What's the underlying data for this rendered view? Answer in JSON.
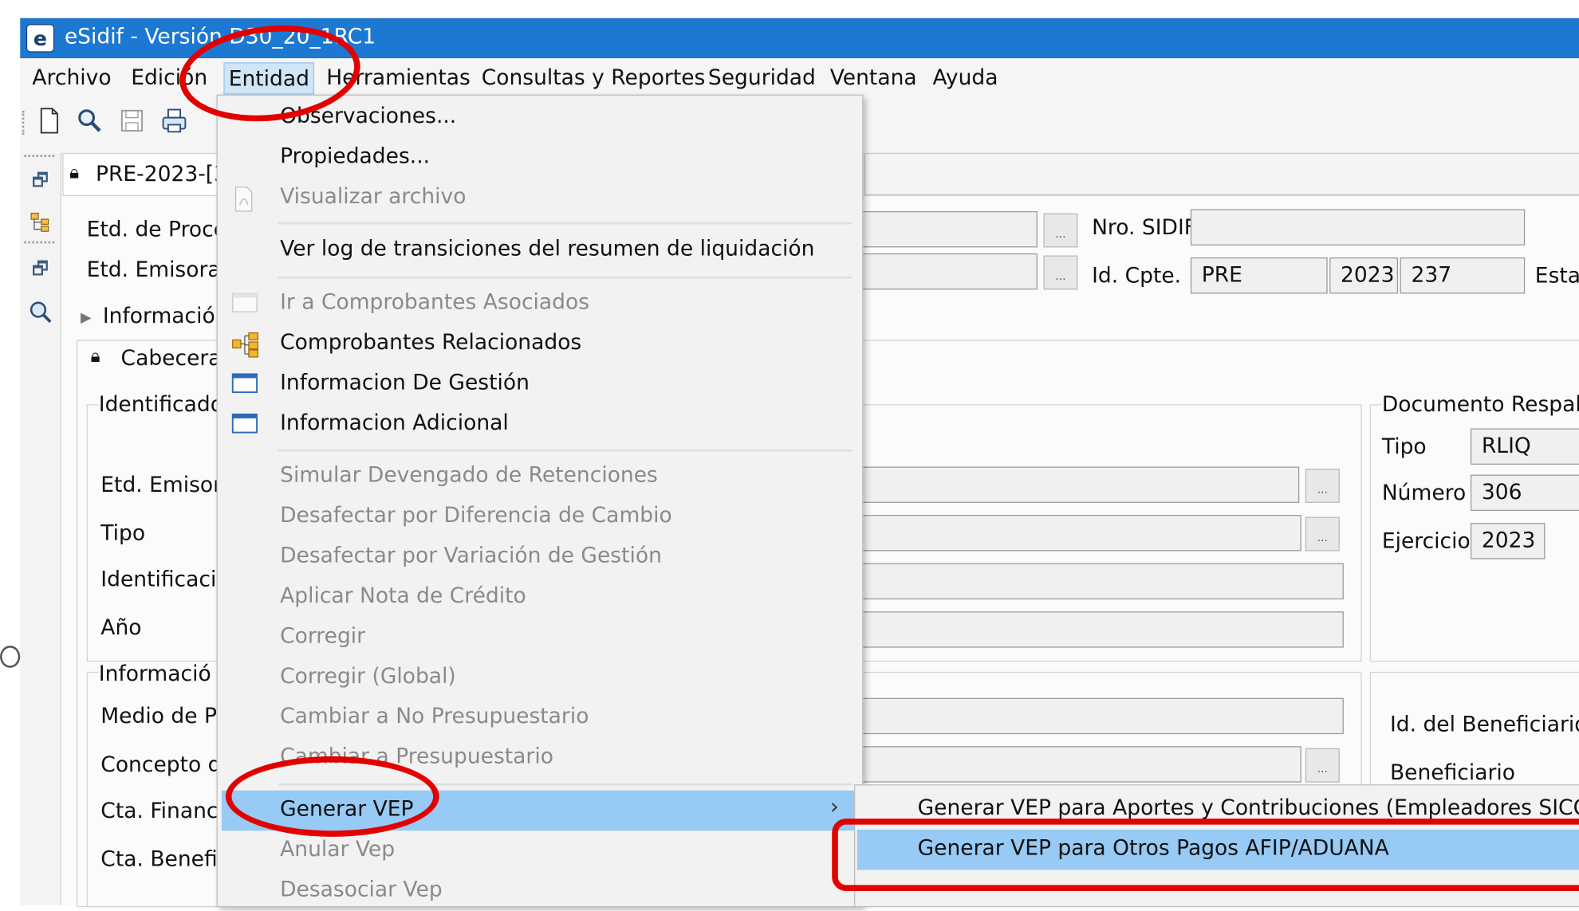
{
  "window": {
    "title": "eSidif - Versión D30_20_1RC1"
  },
  "menubar": [
    {
      "label": "Archivo"
    },
    {
      "label": "Edición"
    },
    {
      "label": "Entidad"
    },
    {
      "label": "Herramientas"
    },
    {
      "label": "Consultas y Reportes"
    },
    {
      "label": "Seguridad"
    },
    {
      "label": "Ventana"
    },
    {
      "label": "Ayuda"
    }
  ],
  "toolbar": {
    "icons": [
      "new-document-icon",
      "search-icon",
      "save-icon",
      "print-icon"
    ]
  },
  "document_tab": {
    "label": "PRE-2023-[3"
  },
  "form": {
    "etd_proceso_label": "Etd. de Proce",
    "etd_emisora_label": "Etd. Emisora",
    "informacion_label": "Información",
    "cabecera_label": "Cabecera",
    "identificacion_label": "Identificado",
    "etd_emisora2_label": "Etd. Emisora",
    "tipo_label": "Tipo",
    "identificacion2_label": "Identificació",
    "anio_label": "Año",
    "informacion2_label": "Informació",
    "medio_pago_label": "Medio de P",
    "concepto_label": "Concepto d",
    "cta_financiera_label": "Cta. Financi",
    "cta_beneficiario_label": "Cta. Benefic",
    "nro_sidif_label": "Nro. SIDIF",
    "nro_sidif_value": "",
    "id_cpte_label": "Id. Cpte.",
    "id_cpte_tipo": "PRE",
    "id_cpte_anio": "2023",
    "id_cpte_numero": "237",
    "estado_label": "Esta",
    "documento_respaldo_label": "Documento Respald",
    "doc_tipo_label": "Tipo",
    "doc_tipo_value": "RLIQ",
    "doc_numero_label": "Número",
    "doc_numero_value": "306",
    "doc_ejercicio_label": "Ejercicio",
    "doc_ejercicio_value": "2023",
    "id_beneficiario_label": "Id. del Beneficiario",
    "beneficiario_label": "Beneficiario"
  },
  "entidad_menu": {
    "items": [
      {
        "label": "Observaciones...",
        "enabled": true
      },
      {
        "label": "Propiedades...",
        "enabled": true
      },
      {
        "label": "Visualizar archivo",
        "enabled": false
      },
      {
        "label": "Ver log de transiciones del resumen de liquidación",
        "enabled": true
      },
      {
        "label": "Ir a Comprobantes Asociados",
        "enabled": false
      },
      {
        "label": "Comprobantes Relacionados",
        "enabled": true
      },
      {
        "label": "Informacion De Gestión",
        "enabled": true
      },
      {
        "label": "Informacion Adicional",
        "enabled": true
      },
      {
        "label": "Simular Devengado de Retenciones",
        "enabled": false
      },
      {
        "label": "Desafectar por Diferencia de Cambio",
        "enabled": false
      },
      {
        "label": "Desafectar por Variación de Gestión",
        "enabled": false
      },
      {
        "label": "Aplicar Nota de Crédito",
        "enabled": false
      },
      {
        "label": "Corregir",
        "enabled": false
      },
      {
        "label": "Corregir (Global)",
        "enabled": false
      },
      {
        "label": "Cambiar a No Presupuestario",
        "enabled": false
      },
      {
        "label": "Cambiar a Presupuestario",
        "enabled": false
      },
      {
        "label": "Generar VEP",
        "enabled": true,
        "highlighted": true
      },
      {
        "label": "Anular Vep",
        "enabled": false
      },
      {
        "label": "Desasociar Vep",
        "enabled": false
      }
    ],
    "submenu_arrow": "›"
  },
  "generar_vep_submenu": {
    "items": [
      {
        "label": "Generar VEP para Aportes y Contribuciones (Empleadores SICOSS)"
      },
      {
        "label": "Generar VEP para Otros Pagos AFIP/ADUANA",
        "highlighted": true
      }
    ]
  },
  "colors": {
    "titlebar": "#1c78d0",
    "menu_highlight": "#97caf4",
    "annotation_red": "#e30000",
    "disabled_text": "#8a8a8a"
  }
}
